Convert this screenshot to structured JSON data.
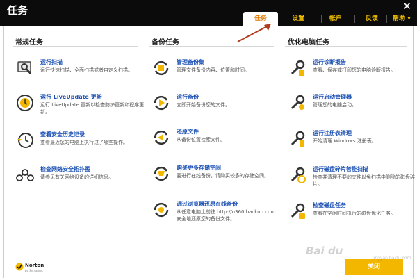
{
  "window": {
    "title": "任务",
    "close_glyph": "✕"
  },
  "tabs": [
    {
      "label": "任务",
      "active": true
    },
    {
      "label": "设置",
      "active": false
    },
    {
      "label": "帐户",
      "active": false
    },
    {
      "label": "反馈",
      "active": false
    },
    {
      "label": "帮助 ▾",
      "active": false
    }
  ],
  "columns": [
    {
      "title": "常规任务"
    },
    {
      "title": "备份任务"
    },
    {
      "title": "优化电脑任务"
    }
  ],
  "tasks": {
    "general": [
      {
        "title": "运行扫描",
        "desc": "运行快速扫描、全面扫描或者自定义扫描。",
        "icon": "scan-icon"
      },
      {
        "title": "运行 LiveUpdate 更新",
        "desc": "运行 LiveUpdate 更新以检查防护更新和程序更新。",
        "icon": "liveupdate-icon"
      },
      {
        "title": "查看安全历史记录",
        "desc": "查看最近您的电脑上执行过了哪些操作。",
        "icon": "history-icon"
      },
      {
        "title": "检查网络安全拓扑图",
        "desc": "请参见有关网络设备的详细信息。",
        "icon": "network-icon"
      }
    ],
    "backup": [
      {
        "title": "管理备份集",
        "desc": "管理文件备份内容、位置和时间。",
        "icon": "backup-set-icon"
      },
      {
        "title": "运行备份",
        "desc": "立即开始备份您的文件。",
        "icon": "run-backup-icon"
      },
      {
        "title": "还原文件",
        "desc": "从备份位置检索文件。",
        "icon": "restore-icon"
      },
      {
        "title": "购买更多存储空间",
        "desc": "要进行在线备份，请购买较多的存储空间。",
        "icon": "buy-storage-icon"
      },
      {
        "title": "通过浏览器还原在线备份",
        "desc": "从任意电脑上前往 http://n360.backup.com 安全地还原您的备份文件。",
        "icon": "browser-restore-icon"
      }
    ],
    "optimize": [
      {
        "title": "运行诊断报告",
        "desc": "查看、保存或打印您的电脑诊断报告。",
        "icon": "diagnostic-icon"
      },
      {
        "title": "运行启动管理器",
        "desc": "管理您的电脑启动。",
        "icon": "startup-icon"
      },
      {
        "title": "运行注册表清理",
        "desc": "开始清理 Windows 注册表。",
        "icon": "registry-icon"
      },
      {
        "title": "运行磁盘碎片智能扫描",
        "desc": "检查并清理不要的文件以免扫描中删除的磁盘碎片。",
        "icon": "defrag-icon"
      },
      {
        "title": "检查磁盘任务",
        "desc": "查看在空闲时间执行的磁盘优化任务。",
        "icon": "disk-check-icon"
      }
    ]
  },
  "footer": {
    "brand": "Norton",
    "brand_sub": "by Symantec",
    "close_button": "关闭"
  },
  "watermark": {
    "text": "Bai du",
    "sub": "jingyan.baidu.com"
  },
  "colors": {
    "titlebar": "#0b0b0b",
    "accent": "#f3b700",
    "link": "#1a4fb3",
    "arrow": "#b23b1e"
  }
}
